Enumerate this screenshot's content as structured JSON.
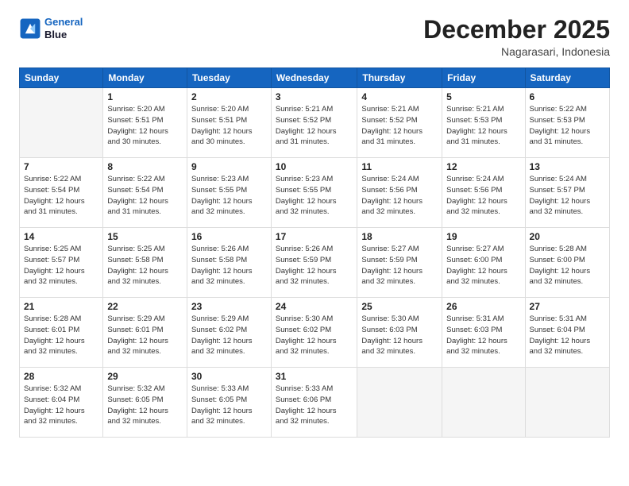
{
  "header": {
    "logo_line1": "General",
    "logo_line2": "Blue",
    "month": "December 2025",
    "location": "Nagarasari, Indonesia"
  },
  "weekdays": [
    "Sunday",
    "Monday",
    "Tuesday",
    "Wednesday",
    "Thursday",
    "Friday",
    "Saturday"
  ],
  "weeks": [
    [
      {
        "day": "",
        "info": ""
      },
      {
        "day": "1",
        "info": "Sunrise: 5:20 AM\nSunset: 5:51 PM\nDaylight: 12 hours\nand 30 minutes."
      },
      {
        "day": "2",
        "info": "Sunrise: 5:20 AM\nSunset: 5:51 PM\nDaylight: 12 hours\nand 30 minutes."
      },
      {
        "day": "3",
        "info": "Sunrise: 5:21 AM\nSunset: 5:52 PM\nDaylight: 12 hours\nand 31 minutes."
      },
      {
        "day": "4",
        "info": "Sunrise: 5:21 AM\nSunset: 5:52 PM\nDaylight: 12 hours\nand 31 minutes."
      },
      {
        "day": "5",
        "info": "Sunrise: 5:21 AM\nSunset: 5:53 PM\nDaylight: 12 hours\nand 31 minutes."
      },
      {
        "day": "6",
        "info": "Sunrise: 5:22 AM\nSunset: 5:53 PM\nDaylight: 12 hours\nand 31 minutes."
      }
    ],
    [
      {
        "day": "7",
        "info": "Sunrise: 5:22 AM\nSunset: 5:54 PM\nDaylight: 12 hours\nand 31 minutes."
      },
      {
        "day": "8",
        "info": "Sunrise: 5:22 AM\nSunset: 5:54 PM\nDaylight: 12 hours\nand 31 minutes."
      },
      {
        "day": "9",
        "info": "Sunrise: 5:23 AM\nSunset: 5:55 PM\nDaylight: 12 hours\nand 32 minutes."
      },
      {
        "day": "10",
        "info": "Sunrise: 5:23 AM\nSunset: 5:55 PM\nDaylight: 12 hours\nand 32 minutes."
      },
      {
        "day": "11",
        "info": "Sunrise: 5:24 AM\nSunset: 5:56 PM\nDaylight: 12 hours\nand 32 minutes."
      },
      {
        "day": "12",
        "info": "Sunrise: 5:24 AM\nSunset: 5:56 PM\nDaylight: 12 hours\nand 32 minutes."
      },
      {
        "day": "13",
        "info": "Sunrise: 5:24 AM\nSunset: 5:57 PM\nDaylight: 12 hours\nand 32 minutes."
      }
    ],
    [
      {
        "day": "14",
        "info": "Sunrise: 5:25 AM\nSunset: 5:57 PM\nDaylight: 12 hours\nand 32 minutes."
      },
      {
        "day": "15",
        "info": "Sunrise: 5:25 AM\nSunset: 5:58 PM\nDaylight: 12 hours\nand 32 minutes."
      },
      {
        "day": "16",
        "info": "Sunrise: 5:26 AM\nSunset: 5:58 PM\nDaylight: 12 hours\nand 32 minutes."
      },
      {
        "day": "17",
        "info": "Sunrise: 5:26 AM\nSunset: 5:59 PM\nDaylight: 12 hours\nand 32 minutes."
      },
      {
        "day": "18",
        "info": "Sunrise: 5:27 AM\nSunset: 5:59 PM\nDaylight: 12 hours\nand 32 minutes."
      },
      {
        "day": "19",
        "info": "Sunrise: 5:27 AM\nSunset: 6:00 PM\nDaylight: 12 hours\nand 32 minutes."
      },
      {
        "day": "20",
        "info": "Sunrise: 5:28 AM\nSunset: 6:00 PM\nDaylight: 12 hours\nand 32 minutes."
      }
    ],
    [
      {
        "day": "21",
        "info": "Sunrise: 5:28 AM\nSunset: 6:01 PM\nDaylight: 12 hours\nand 32 minutes."
      },
      {
        "day": "22",
        "info": "Sunrise: 5:29 AM\nSunset: 6:01 PM\nDaylight: 12 hours\nand 32 minutes."
      },
      {
        "day": "23",
        "info": "Sunrise: 5:29 AM\nSunset: 6:02 PM\nDaylight: 12 hours\nand 32 minutes."
      },
      {
        "day": "24",
        "info": "Sunrise: 5:30 AM\nSunset: 6:02 PM\nDaylight: 12 hours\nand 32 minutes."
      },
      {
        "day": "25",
        "info": "Sunrise: 5:30 AM\nSunset: 6:03 PM\nDaylight: 12 hours\nand 32 minutes."
      },
      {
        "day": "26",
        "info": "Sunrise: 5:31 AM\nSunset: 6:03 PM\nDaylight: 12 hours\nand 32 minutes."
      },
      {
        "day": "27",
        "info": "Sunrise: 5:31 AM\nSunset: 6:04 PM\nDaylight: 12 hours\nand 32 minutes."
      }
    ],
    [
      {
        "day": "28",
        "info": "Sunrise: 5:32 AM\nSunset: 6:04 PM\nDaylight: 12 hours\nand 32 minutes."
      },
      {
        "day": "29",
        "info": "Sunrise: 5:32 AM\nSunset: 6:05 PM\nDaylight: 12 hours\nand 32 minutes."
      },
      {
        "day": "30",
        "info": "Sunrise: 5:33 AM\nSunset: 6:05 PM\nDaylight: 12 hours\nand 32 minutes."
      },
      {
        "day": "31",
        "info": "Sunrise: 5:33 AM\nSunset: 6:06 PM\nDaylight: 12 hours\nand 32 minutes."
      },
      {
        "day": "",
        "info": ""
      },
      {
        "day": "",
        "info": ""
      },
      {
        "day": "",
        "info": ""
      }
    ]
  ]
}
